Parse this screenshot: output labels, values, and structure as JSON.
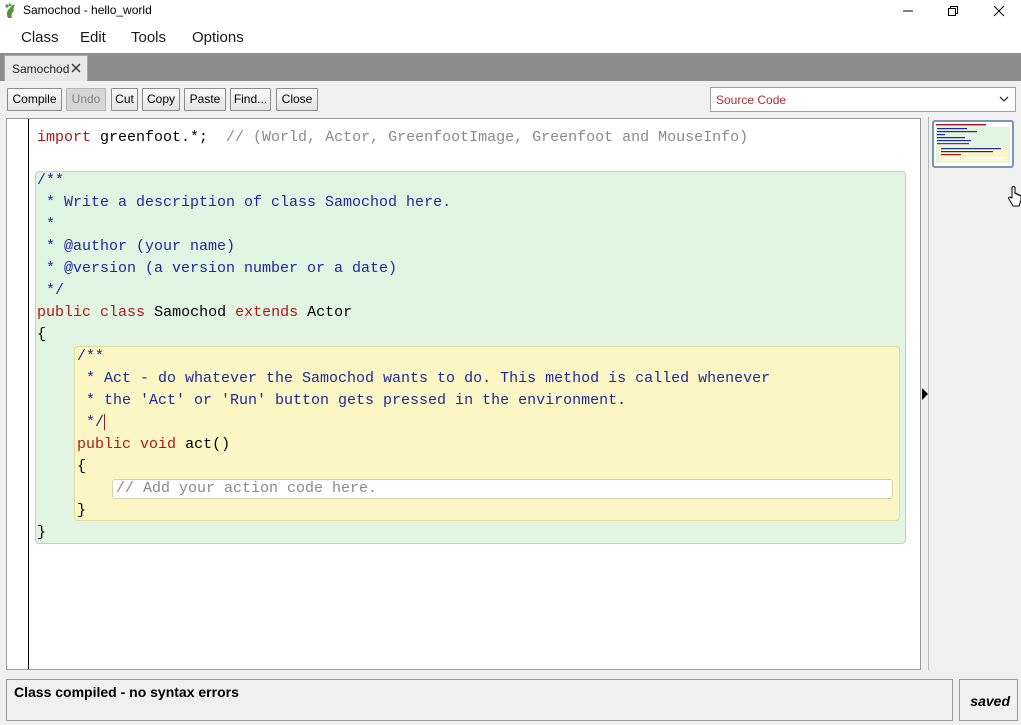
{
  "window": {
    "title": "Samochod - hello_world"
  },
  "menu": {
    "items": [
      "Class",
      "Edit",
      "Tools",
      "Options"
    ]
  },
  "tabs": [
    {
      "label": "Samochod"
    }
  ],
  "toolbar": {
    "compile": "Compile",
    "undo": "Undo",
    "cut": "Cut",
    "copy": "Copy",
    "paste": "Paste",
    "find": "Find...",
    "close": "Close",
    "view_selected": "Source Code"
  },
  "code": {
    "import_kw": "import",
    "import_rest": " greenfoot.*;  ",
    "import_comment": "// (World, Actor, GreenfootImage, Greenfoot and MouseInfo)",
    "class_doc": [
      "/**",
      " * Write a description of class Samochod here.",
      " *",
      " * @author (your name)",
      " * @version (a version number or a date)",
      " */"
    ],
    "class_decl": {
      "kw1": "public",
      "kw2": "class",
      "name": "Samochod",
      "kw3": "extends",
      "parent": "Actor"
    },
    "open_brace": "{",
    "method_doc": [
      "/**",
      " * Act - do whatever the Samochod wants to do. This method is called whenever",
      " * the 'Act' or 'Run' button gets pressed in the environment.",
      " */"
    ],
    "method_decl": {
      "kw1": "public",
      "kw2": "void",
      "name": "act()"
    },
    "method_open": "{",
    "body_comment": "// Add your action code here.",
    "method_close": "}",
    "class_close": "}"
  },
  "status": {
    "message": "Class compiled - no syntax errors",
    "saved": "saved"
  },
  "colors": {
    "keyword": "#b01818",
    "comment": "#1d2a9e",
    "class_scope": "#e2f4e2",
    "method_scope": "#fbf6c4"
  },
  "icons": {
    "app": "greenfoot-foot-icon",
    "close_tab": "close-icon",
    "dropdown": "chevron-down-icon"
  }
}
